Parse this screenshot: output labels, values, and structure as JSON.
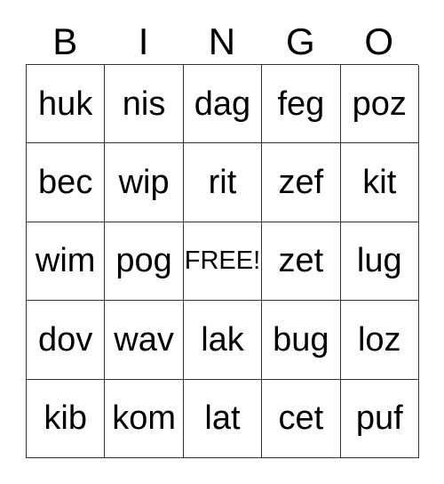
{
  "card": {
    "title": "BINGO",
    "columns": [
      "B",
      "I",
      "N",
      "G",
      "O"
    ],
    "free_space_label": "FREE!",
    "colors": {
      "background": "#ffffff",
      "grid_line": "#333333",
      "text": "#000000"
    },
    "rows": [
      {
        "cells": [
          "huk",
          "nis",
          "dag",
          "feg",
          "poz"
        ]
      },
      {
        "cells": [
          "bec",
          "wip",
          "rit",
          "zef",
          "kit"
        ]
      },
      {
        "cells": [
          "wim",
          "pog",
          "FREE!",
          "zet",
          "lug"
        ]
      },
      {
        "cells": [
          "dov",
          "wav",
          "lak",
          "bug",
          "loz"
        ]
      },
      {
        "cells": [
          "kib",
          "kom",
          "lat",
          "cet",
          "puf"
        ]
      }
    ]
  }
}
